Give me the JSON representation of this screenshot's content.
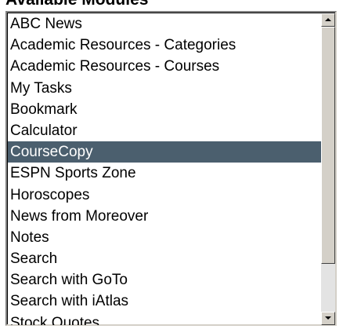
{
  "section": {
    "title": "Available Modules"
  },
  "listbox": {
    "items": [
      "ABC News",
      "Academic Resources - Categories",
      "Academic Resources - Courses",
      "My Tasks",
      "Bookmark",
      "Calculator",
      "CourseCopy",
      "ESPN Sports Zone",
      "Horoscopes",
      "News from Moreover",
      "Notes",
      "Search",
      "Search with GoTo",
      "Search with iAtlas",
      "Stock Quotes"
    ],
    "selected_index": 6,
    "selected_color": "#4b5f6e"
  },
  "scrollbar": {
    "up_icon": "arrow-up-icon",
    "down_icon": "arrow-down-icon"
  }
}
